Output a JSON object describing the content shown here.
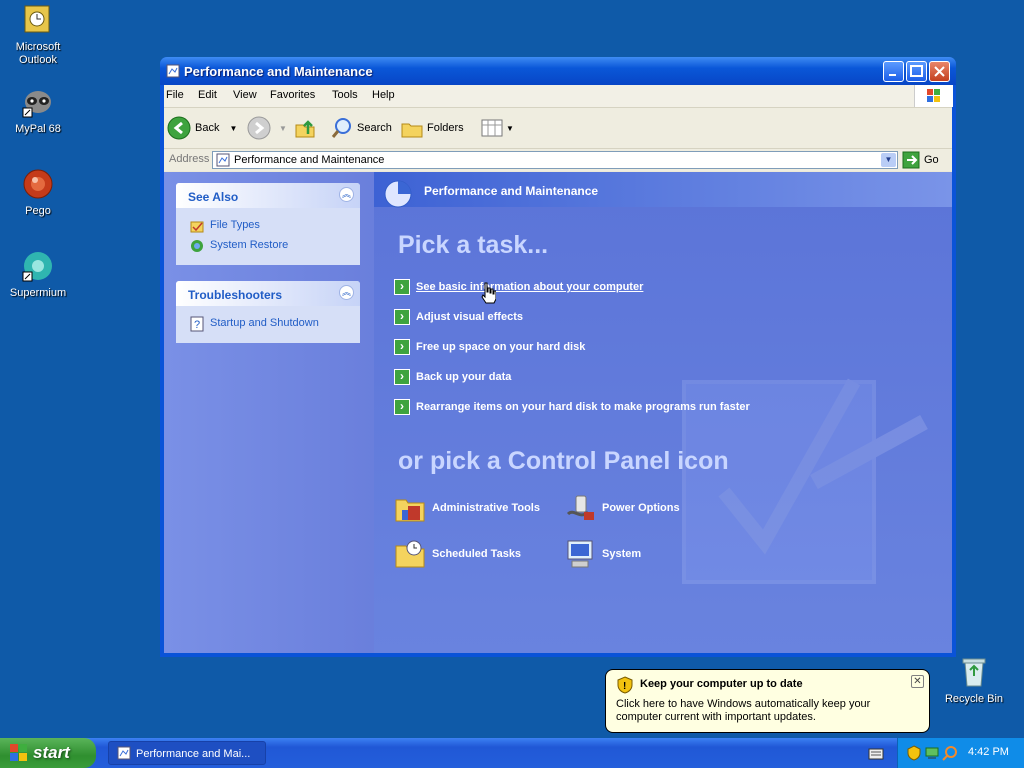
{
  "desktop": {
    "icons": [
      {
        "label": "Microsoft\nOutlook"
      },
      {
        "label": "MyPal 68"
      },
      {
        "label": "Pego"
      },
      {
        "label": "Supermium"
      },
      {
        "label": "Recycle Bin"
      }
    ]
  },
  "window": {
    "title": "Performance and Maintenance",
    "menu": [
      "File",
      "Edit",
      "View",
      "Favorites",
      "Tools",
      "Help"
    ],
    "toolbar": {
      "back": "Back",
      "search": "Search",
      "folders": "Folders"
    },
    "address": {
      "label": "Address",
      "value": "Performance and Maintenance",
      "go": "Go"
    },
    "see_also": {
      "title": "See Also",
      "items": [
        "File Types",
        "System Restore"
      ]
    },
    "troubleshooters": {
      "title": "Troubleshooters",
      "items": [
        "Startup and Shutdown"
      ]
    },
    "main": {
      "header": "Performance and Maintenance",
      "pick_task": "Pick a task...",
      "tasks": [
        "See basic information about your computer",
        "Adjust visual effects",
        "Free up space on your hard disk",
        "Back up your data",
        "Rearrange items on your hard disk to make programs run faster"
      ],
      "pick_icon": "or pick a Control Panel icon",
      "icons": [
        "Administrative Tools",
        "Power Options",
        "Scheduled Tasks",
        "System"
      ]
    }
  },
  "taskbar": {
    "start": "start",
    "task_item": "Performance and Mai...",
    "clock": "4:42 PM"
  },
  "balloon": {
    "title": "Keep your computer up to date",
    "body": "Click here to have Windows automatically keep your computer current with important updates."
  },
  "colors": {
    "desktop": "#0f5aa8",
    "title_blue": "#0a57d8",
    "pane_blue": "#6b80de",
    "link_blue": "#215dc6"
  }
}
